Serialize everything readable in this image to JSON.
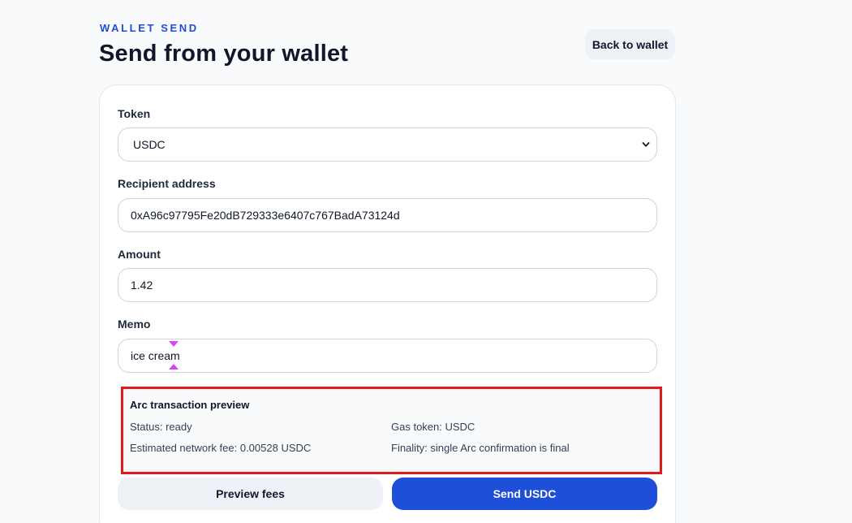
{
  "header": {
    "eyebrow": "WALLET SEND",
    "title": "Send from your wallet",
    "back_label": "Back to wallet"
  },
  "form": {
    "token": {
      "label": "Token",
      "value": "USDC"
    },
    "recipient": {
      "label": "Recipient address",
      "value": "0xA96c97795Fe20dB729333e6407c767BadA73124d"
    },
    "amount": {
      "label": "Amount",
      "value": "1.42"
    },
    "memo": {
      "label": "Memo",
      "value": "ice cream"
    }
  },
  "preview": {
    "title": "Arc transaction preview",
    "status": "Status: ready",
    "gas_token": "Gas token: USDC",
    "fee": "Estimated network fee: 0.00528 USDC",
    "finality": "Finality: single Arc confirmation is final"
  },
  "actions": {
    "preview_fees_label": "Preview fees",
    "send_label": "Send USDC"
  },
  "colors": {
    "accent": "#1d4fd8",
    "highlight_border": "#e01b1b",
    "cursor": "#d946ef"
  },
  "icons": {
    "token_select": "chevron-down-icon",
    "memo_cursor": "text-cursor-icon"
  }
}
